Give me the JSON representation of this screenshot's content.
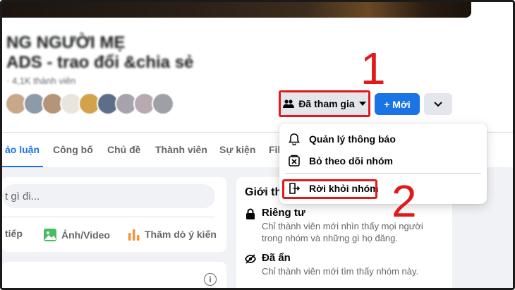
{
  "group": {
    "title_line1": "NG NGƯỜI MẸ",
    "title_line2": "ADS - trao đổi &chia sẻ",
    "meta": "· 4,1K thành viên"
  },
  "header_actions": {
    "joined_label": "Đã tham gia",
    "new_label": "+ Mới"
  },
  "dropdown_menu": {
    "items": [
      {
        "label": "Quản lý thông báo",
        "icon": "bell-icon"
      },
      {
        "label": "Bỏ theo dõi nhóm",
        "icon": "unfollow-icon"
      },
      {
        "label": "Rời khỏi nhóm",
        "icon": "leave-group-icon"
      }
    ]
  },
  "annotations": {
    "step1": "1",
    "step2": "2",
    "color": "#e0191b"
  },
  "tabs": [
    {
      "label": "ảo luận",
      "active": true
    },
    {
      "label": "Công bố"
    },
    {
      "label": "Chủ đề"
    },
    {
      "label": "Thành viên"
    },
    {
      "label": "Sự kiện"
    },
    {
      "label": "Fil"
    }
  ],
  "composer": {
    "placeholder": "t gì đi...",
    "actions": [
      {
        "label": "tiếp"
      },
      {
        "label": "Ảnh/Video",
        "icon": "photo-icon"
      },
      {
        "label": "Thăm dò ý kiến",
        "icon": "poll-icon"
      }
    ]
  },
  "about": {
    "title": "Giới thi",
    "private_title": "Riêng tư",
    "private_desc": "Chỉ thành viên mới nhìn thấy mọi người trong nhóm và những gì họ đăng.",
    "hidden_title": "Đã ẩn",
    "hidden_desc": "Chỉ thành viên mới tìm thấy nhóm này."
  },
  "colors": {
    "brand_blue": "#1b74e4",
    "secondary_gray": "#e4e6eb",
    "feed_bg": "#f0f2f5"
  }
}
